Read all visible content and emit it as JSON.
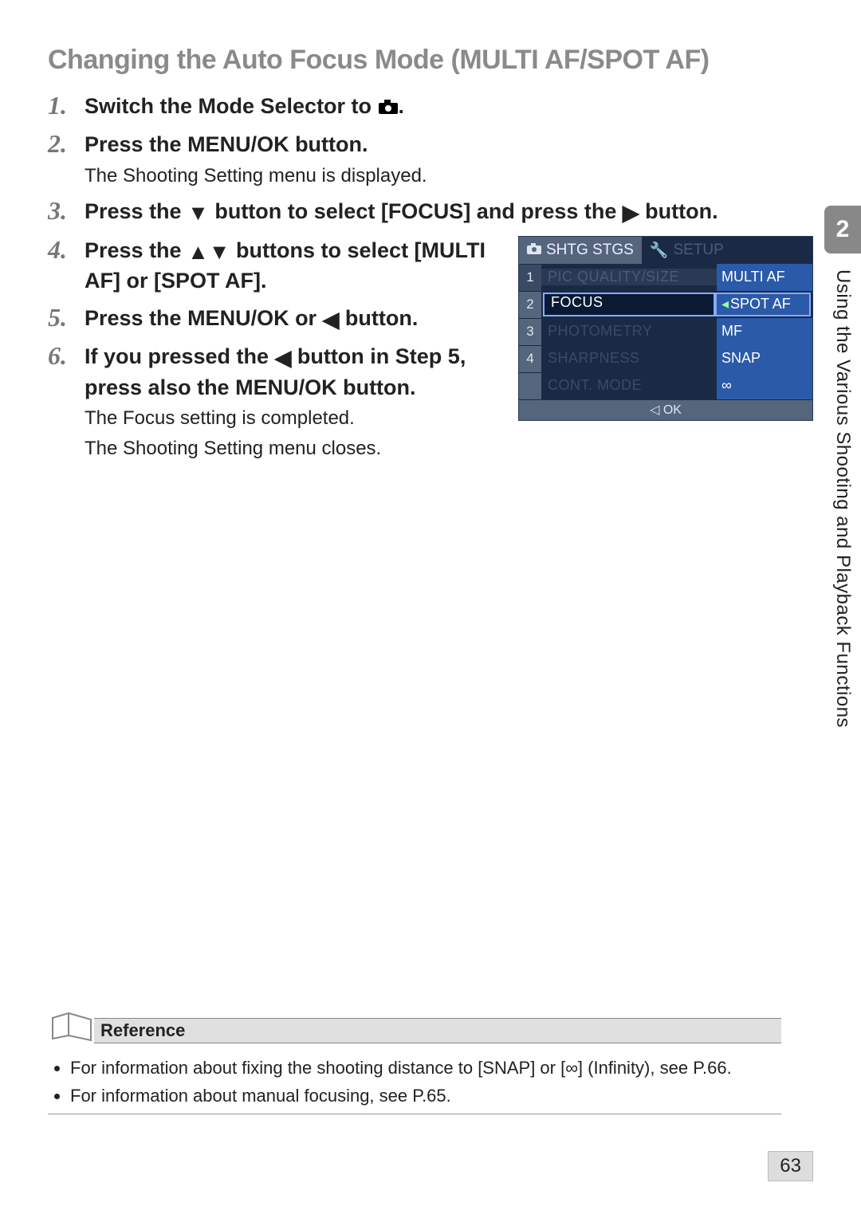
{
  "title": "Changing the Auto Focus Mode (MULTI AF/SPOT AF)",
  "steps": {
    "s1": {
      "title_a": "Switch the Mode Selector to ",
      "title_b": "."
    },
    "s2": {
      "title": "Press the MENU/OK button.",
      "sub": "The Shooting Setting menu is displayed."
    },
    "s3": {
      "title_a": "Press the ",
      "title_b": " button to select [FOCUS] and press the ",
      "title_c": " button."
    },
    "s4": {
      "title_a": "Press the ",
      "title_b": " buttons to select [MULTI AF] or [SPOT AF]."
    },
    "s5": {
      "title_a": "Press the MENU/OK or ",
      "title_b": " button."
    },
    "s6": {
      "title_a": "If you pressed the ",
      "title_b": " button in Step 5, press also the MENU/OK button.",
      "sub1": "The Focus setting is completed.",
      "sub2": "The Shooting Setting menu closes."
    }
  },
  "cam": {
    "tab_active": "SHTG STGS",
    "tab_inactive": "SETUP",
    "rows": {
      "r1": {
        "n": "1",
        "left": "PIC QUALITY/SIZE",
        "right": "MULTI AF"
      },
      "r2": {
        "n": "2",
        "left": "FOCUS",
        "right": "SPOT AF"
      },
      "r3": {
        "n": "3",
        "left": "PHOTOMETRY",
        "right": "MF"
      },
      "r4": {
        "n": "4",
        "left": "SHARPNESS",
        "right": "SNAP"
      },
      "r5": {
        "n": "",
        "left": "CONT. MODE",
        "right": "∞"
      }
    },
    "foot": "◁ OK"
  },
  "reference": {
    "heading": "Reference",
    "b1_a": "For information about fixing the shooting distance to [SNAP] or [",
    "b1_b": "] (Infinity), see P.66.",
    "b2": "For information about manual focusing, see P.65."
  },
  "sidetab": {
    "num": "2",
    "text": "Using the Various Shooting and Playback Functions"
  },
  "pagenum": "63"
}
